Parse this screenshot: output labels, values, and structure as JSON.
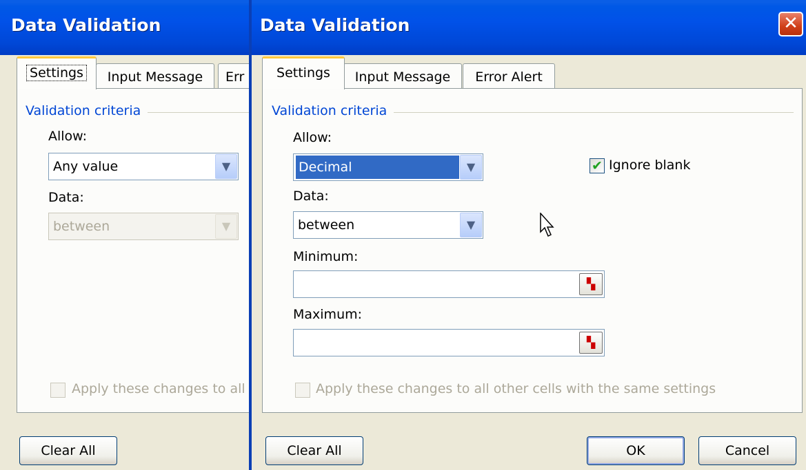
{
  "left_dialog": {
    "title": "Data Validation",
    "tabs": [
      "Settings",
      "Input Message",
      "Err"
    ],
    "legend": "Validation criteria",
    "allow_label": "Allow:",
    "allow_value": "Any value",
    "data_label": "Data:",
    "data_value": "between",
    "apply_label": "Apply these changes to all",
    "clear_all_label": "Clear All"
  },
  "right_dialog": {
    "title": "Data Validation",
    "close_glyph": "✕",
    "tabs": [
      "Settings",
      "Input Message",
      "Error Alert"
    ],
    "legend": "Validation criteria",
    "allow_label": "Allow:",
    "allow_value": "Decimal",
    "ignore_blank_label": "Ignore blank",
    "ignore_blank_checked": true,
    "data_label": "Data:",
    "data_value": "between",
    "minimum_label": "Minimum:",
    "minimum_value": "",
    "maximum_label": "Maximum:",
    "maximum_value": "",
    "apply_label": "Apply these changes to all other cells with the same settings",
    "clear_all_label": "Clear All",
    "ok_label": "OK",
    "cancel_label": "Cancel"
  },
  "icons": {
    "dropdown": "chevron-down-icon",
    "range_ref": "range-select-icon",
    "cursor": "mouse-pointer-icon"
  }
}
